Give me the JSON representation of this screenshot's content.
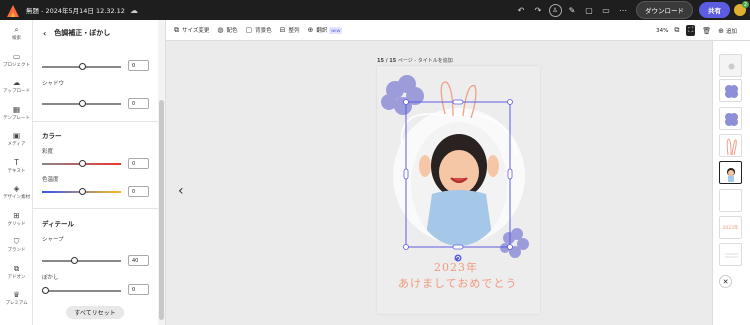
{
  "topbar": {
    "doc_title": "無題 - 2024年5月14日 12.32.12",
    "download_label": "ダウンロード",
    "share_label": "共有",
    "avatar_badge": "2"
  },
  "leftnav": [
    {
      "label": "検索",
      "icon": "search-icon",
      "glyph": "⌕"
    },
    {
      "label": "プロジェクト",
      "icon": "folder-icon",
      "glyph": "▭"
    },
    {
      "label": "アップロード",
      "icon": "upload-cloud-icon",
      "glyph": "☁"
    },
    {
      "label": "テンプレート",
      "icon": "template-icon",
      "glyph": "▦"
    },
    {
      "label": "メディア",
      "icon": "media-icon",
      "glyph": "▣"
    },
    {
      "label": "テキスト",
      "icon": "text-icon",
      "glyph": "T"
    },
    {
      "label": "デザイン素材",
      "icon": "shapes-icon",
      "glyph": "◈"
    },
    {
      "label": "グリッド",
      "icon": "grid-icon",
      "glyph": "⊞"
    },
    {
      "label": "ブランド",
      "icon": "brand-icon",
      "glyph": "⛉"
    },
    {
      "label": "アドオン",
      "icon": "addons-icon",
      "glyph": "⧉"
    },
    {
      "label": "プレミアム",
      "icon": "crown-icon",
      "glyph": "♛"
    }
  ],
  "panel": {
    "title": "色調補正・ぼかし",
    "sliders": [
      {
        "label": "",
        "value": "0",
        "fraction": 0.5
      },
      {
        "label": "シャドウ",
        "value": "0",
        "fraction": 0.5
      },
      {
        "label": "彩度",
        "value": "0",
        "fraction": 0.5
      },
      {
        "label": "色温度",
        "value": "0",
        "fraction": 0.5
      },
      {
        "label": "シャープ",
        "value": "40",
        "fraction": 0.4
      },
      {
        "label": "ぼかし",
        "value": "0",
        "fraction": 0.0
      }
    ],
    "section_color": "カラー",
    "section_detail": "ディテール",
    "reset_label": "すべてリセット"
  },
  "toolbar": {
    "resize": "サイズ変更",
    "color_scheme": "配色",
    "background": "背景色",
    "arrange": "整列",
    "translate": "翻訳",
    "new_badge": "NEW",
    "zoom": "34%",
    "add_label": "追加"
  },
  "canvas": {
    "page_label_num": "15 / 15",
    "page_label_text": "ページ - タイトルを追加",
    "year_text": "2023年",
    "greeting_text": "あけましておめでとう"
  },
  "thumbs": {
    "text_thumb": "2023年"
  },
  "colors": {
    "accent": "#5c5ce0",
    "flower": "#8e8fd8",
    "greeting": "#f09a80"
  }
}
